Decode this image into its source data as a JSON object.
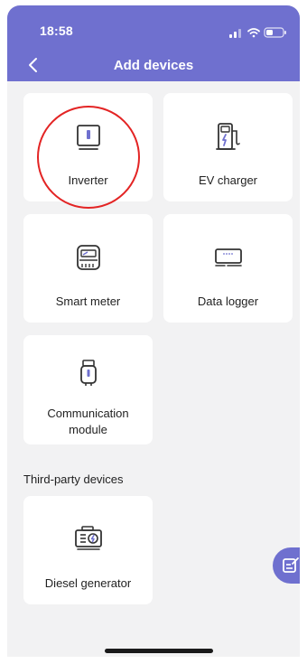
{
  "status_bar": {
    "time": "18:58",
    "icons": [
      "signal-icon",
      "wifi-icon",
      "battery-icon"
    ]
  },
  "header": {
    "title": "Add devices",
    "back_icon": "chevron-left-icon"
  },
  "devices": [
    {
      "label": "Inverter",
      "icon": "inverter-icon"
    },
    {
      "label": "EV charger",
      "icon": "ev-charger-icon"
    },
    {
      "label": "Smart meter",
      "icon": "smart-meter-icon"
    },
    {
      "label": "Data logger",
      "icon": "data-logger-icon"
    },
    {
      "label": "Communication\nmodule",
      "icon": "communication-module-icon"
    }
  ],
  "third_party": {
    "title": "Third-party devices",
    "devices": [
      {
        "label": "Diesel generator",
        "icon": "diesel-generator-icon"
      }
    ]
  },
  "floating_button": {
    "icon": "note-edit-icon"
  },
  "colors": {
    "accent": "#6f70cf",
    "background": "#f2f2f3",
    "card": "#ffffff",
    "highlight": "#e32424"
  }
}
